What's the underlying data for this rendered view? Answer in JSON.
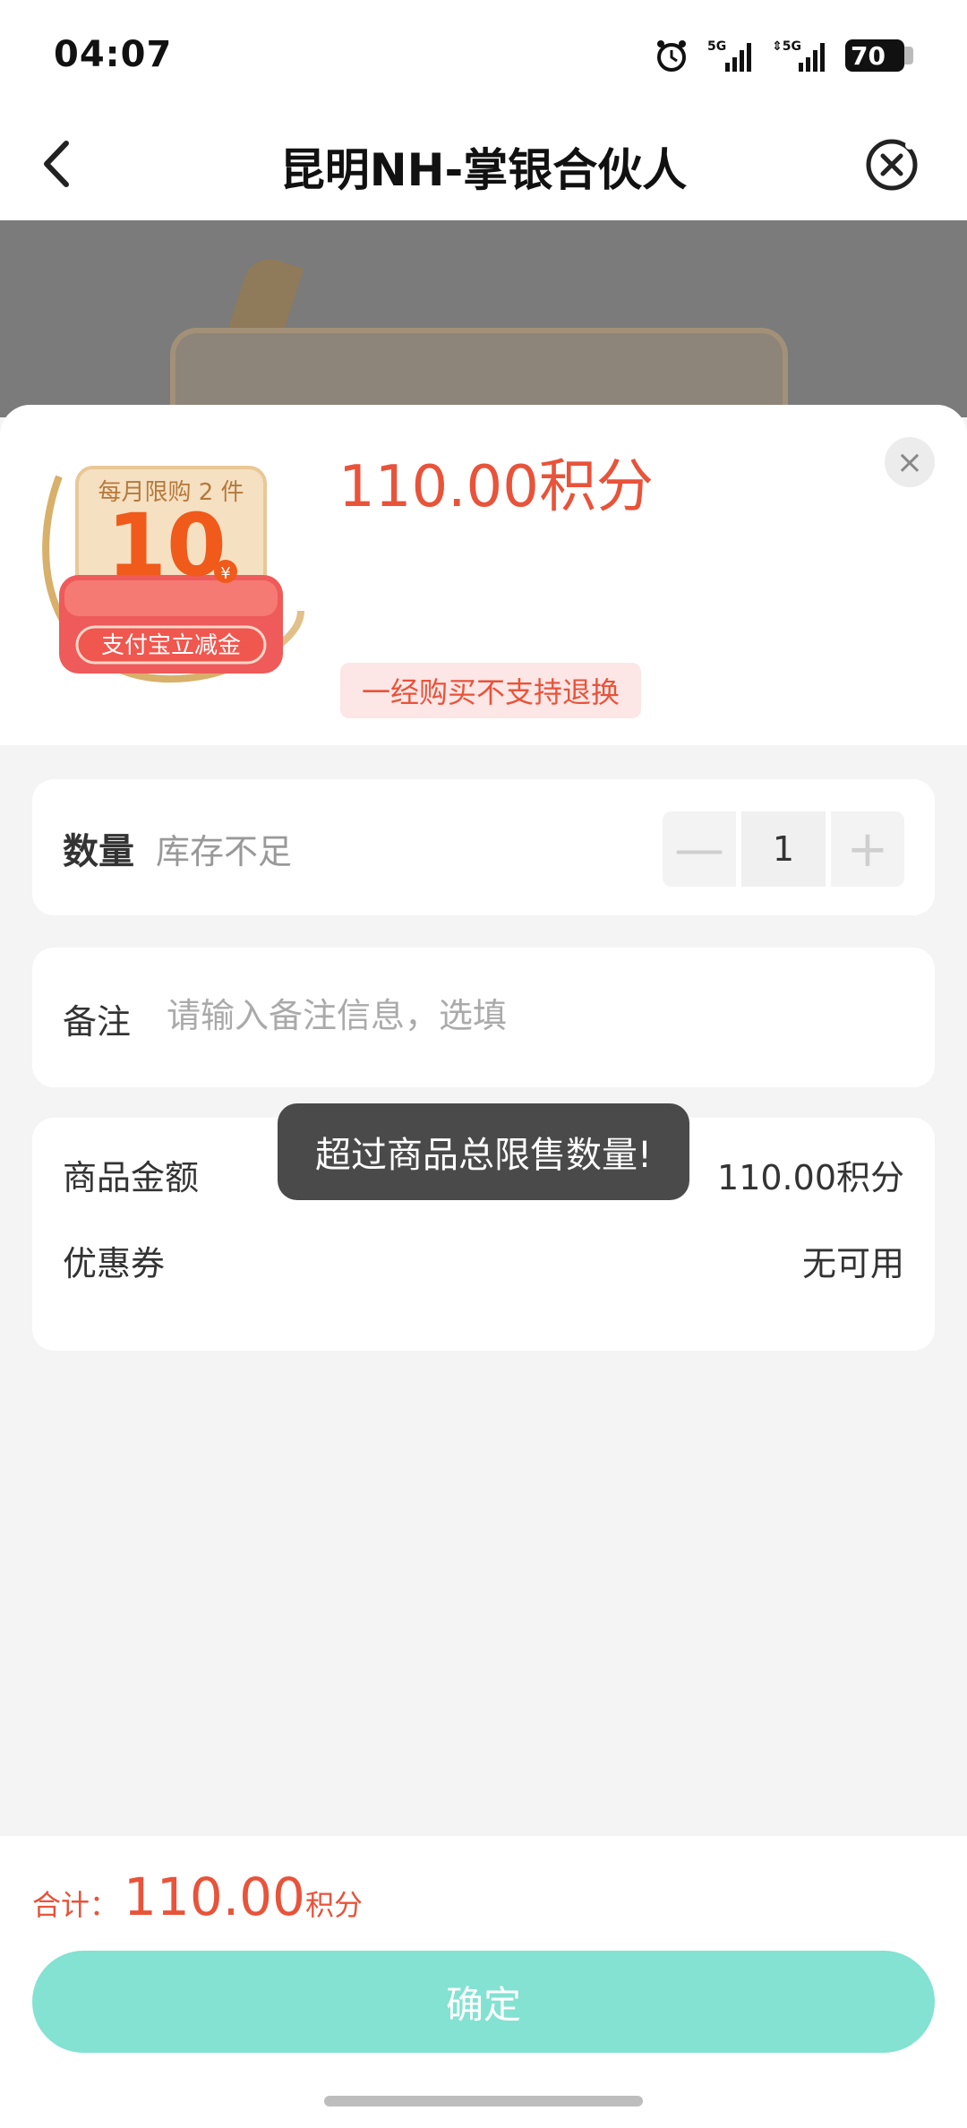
{
  "status_bar": {
    "time": "04:07",
    "battery": "70"
  },
  "nav": {
    "title": "昆明NH-掌银合伙人"
  },
  "product": {
    "badge_top": "每月限购 2 件",
    "badge_value": "10",
    "badge_currency": "¥",
    "badge_bottom": "支付宝立减金",
    "price": "110.00积分",
    "tag": "一经购买不支持退换"
  },
  "quantity": {
    "label": "数量",
    "stock_status": "库存不足",
    "value": "1"
  },
  "note": {
    "label": "备注",
    "placeholder": "请输入备注信息，选填"
  },
  "summary": {
    "goods_label": "商品金额",
    "goods_value": "110.00积分",
    "coupon_label": "优惠券",
    "coupon_value": "无可用"
  },
  "toast": {
    "message": "超过商品总限售数量!"
  },
  "footer": {
    "total_label": "合计：",
    "total_amount": "110.00",
    "total_unit": "积分",
    "confirm_label": "确定"
  },
  "colors": {
    "accent": "#e8533a",
    "confirm": "#83e2d2"
  }
}
